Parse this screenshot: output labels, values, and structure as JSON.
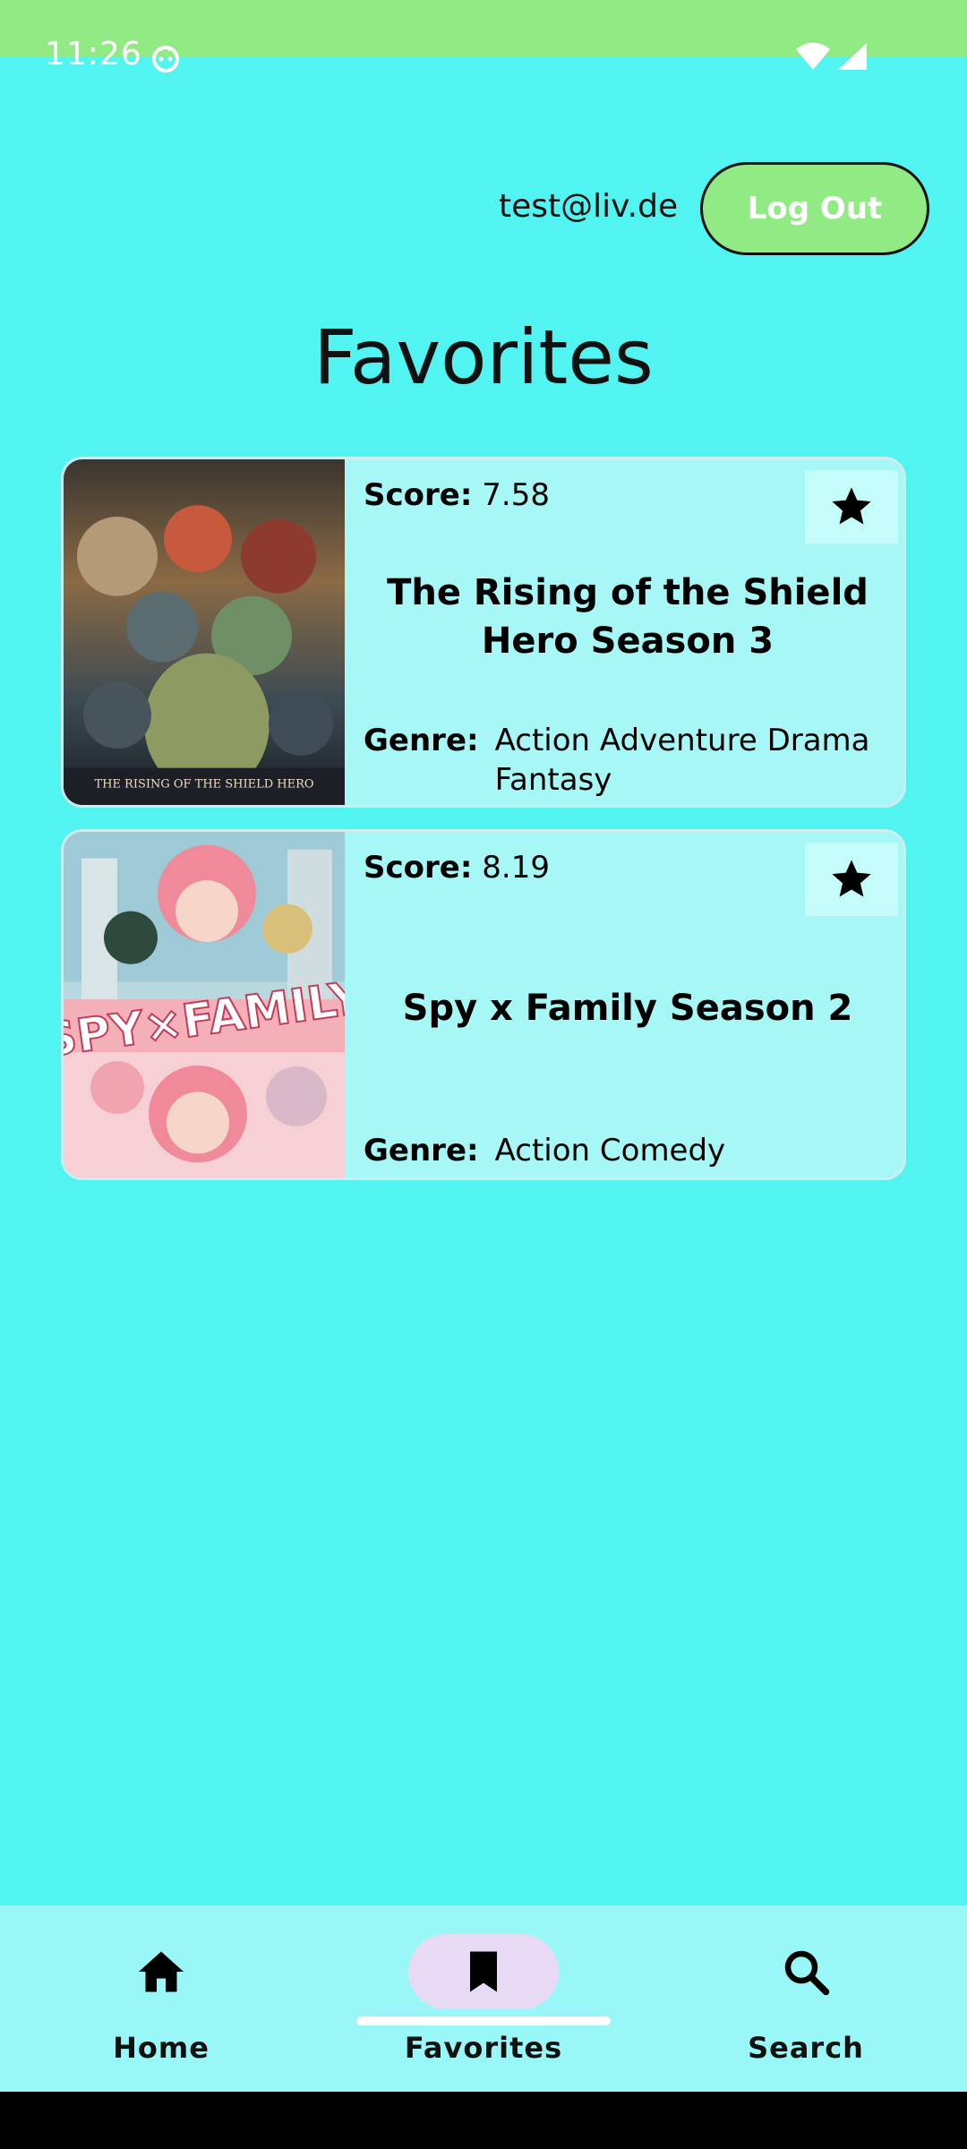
{
  "status_bar": {
    "time": "11:26",
    "icons": [
      "app-notification-icon",
      "wifi-icon",
      "signal-icon"
    ]
  },
  "header": {
    "email": "test@liv.de",
    "logout_label": "Log Out"
  },
  "page_title": "Favorites",
  "favorites": [
    {
      "score_label": "Score:",
      "score": "7.58",
      "title": "The Rising of the Shield Hero Season 3",
      "genre_label": "Genre:",
      "genre": "Action Adventure Drama Fantasy",
      "favorite_icon": "star-icon"
    },
    {
      "score_label": "Score:",
      "score": "8.19",
      "title": "Spy x Family Season 2",
      "genre_label": "Genre:",
      "genre": "Action Comedy",
      "favorite_icon": "star-icon"
    }
  ],
  "bottom_nav": {
    "items": [
      {
        "label": "Home",
        "icon": "home-icon",
        "active": false
      },
      {
        "label": "Favorites",
        "icon": "bookmark-icon",
        "active": true
      },
      {
        "label": "Search",
        "icon": "search-icon",
        "active": false
      }
    ]
  },
  "colors": {
    "background": "#52F4F2",
    "status_bar": "#92EA84",
    "accent_button": "#92EA84",
    "card": "#A6F7F6",
    "nav_bar": "#9AF7F7",
    "nav_active_pill": "#E8DAF5"
  }
}
